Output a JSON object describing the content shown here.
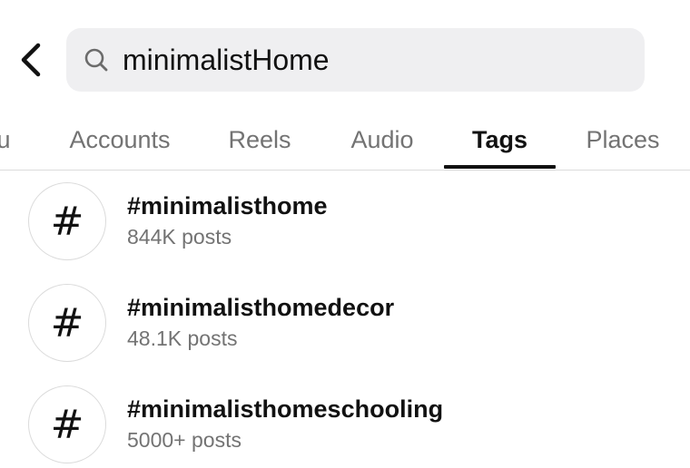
{
  "search": {
    "value": "minimalistHome",
    "back_icon": "chevron-left-icon",
    "search_icon": "search-icon"
  },
  "tabs": [
    {
      "label": "u",
      "active": false
    },
    {
      "label": "Accounts",
      "active": false
    },
    {
      "label": "Reels",
      "active": false
    },
    {
      "label": "Audio",
      "active": false
    },
    {
      "label": "Tags",
      "active": true
    },
    {
      "label": "Places",
      "active": false
    }
  ],
  "results": [
    {
      "icon": "hashtag-icon",
      "symbol": "#",
      "name": "#minimalisthome",
      "count": "844K posts"
    },
    {
      "icon": "hashtag-icon",
      "symbol": "#",
      "name": "#minimalisthomedecor",
      "count": "48.1K posts"
    },
    {
      "icon": "hashtag-icon",
      "symbol": "#",
      "name": "#minimalisthomeschooling",
      "count": "5000+ posts"
    }
  ],
  "colors": {
    "search_bg": "#efeff1",
    "inactive_tab": "#737373",
    "active_tab": "#111111",
    "divider": "#dbdbdb"
  }
}
